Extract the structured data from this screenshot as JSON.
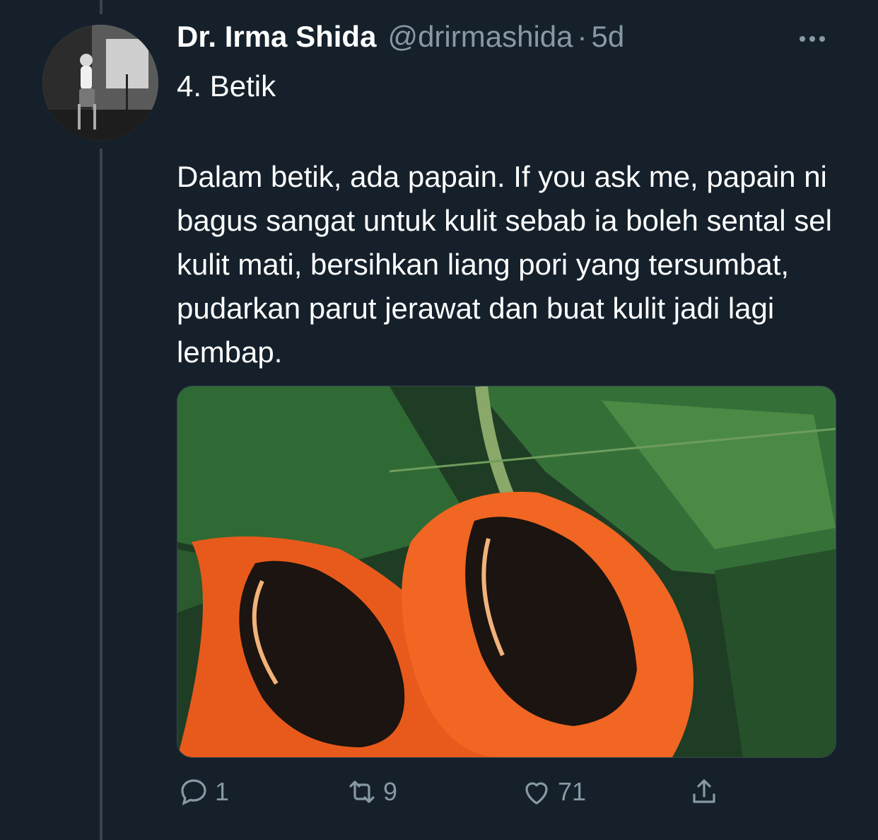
{
  "author": {
    "display_name": "Dr. Irma Shida",
    "handle": "@drirmashida",
    "separator": "·",
    "timestamp": "5d"
  },
  "tweet": {
    "title": "4. Betik",
    "body": "Dalam betik, ada papain. If you ask me, papain ni bagus sangat untuk kulit sebab ia boleh sental sel kulit mati, bersihkan liang pori yang tersumbat, pudarkan parut jerawat dan buat kulit jadi lagi lembap."
  },
  "actions": {
    "reply_count": "1",
    "retweet_count": "9",
    "like_count": "71"
  },
  "icons": [
    "more-icon",
    "reply-icon",
    "retweet-icon",
    "like-icon",
    "share-icon"
  ],
  "colors": {
    "background": "#15202b",
    "secondary_text": "#8899a6",
    "thread_line": "#38444d"
  }
}
